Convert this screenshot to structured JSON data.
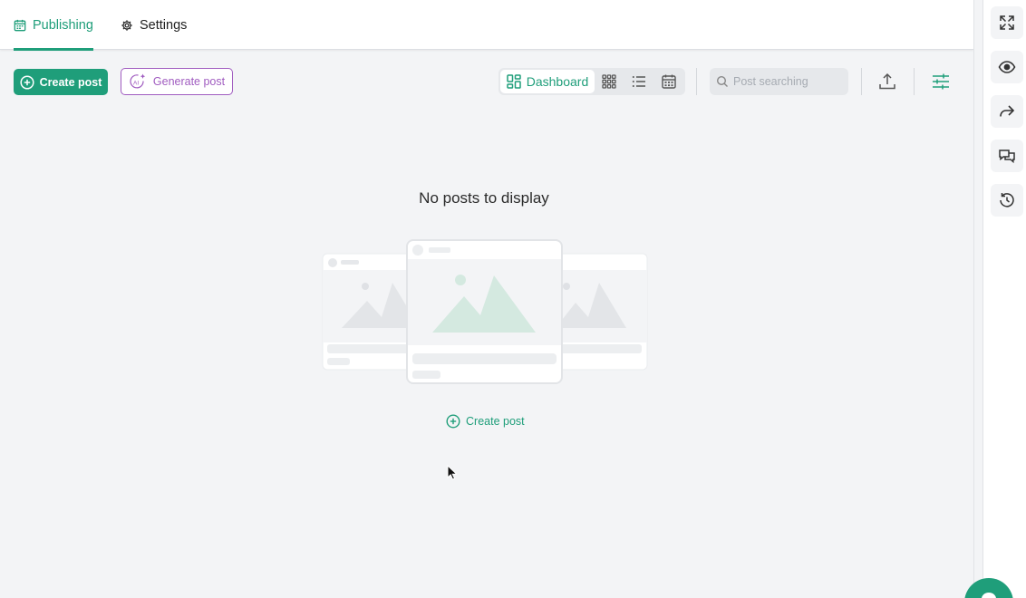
{
  "tabs": {
    "publishing": "Publishing",
    "settings": "Settings"
  },
  "toolbar": {
    "create_post": "Create post",
    "generate_post": "Generate post",
    "view_dashboard": "Dashboard",
    "search_placeholder": "Post searching"
  },
  "empty_state": {
    "title": "No posts to display",
    "create_post": "Create post"
  },
  "colors": {
    "accent": "#1f9e7a",
    "ai_purple": "#a05cc0",
    "background": "#f3f4f6"
  },
  "icons": [
    "calendar-icon",
    "gear-icon",
    "plus-circle-icon",
    "ai-sparkle-icon",
    "dashboard-icon",
    "grid-icon",
    "list-icon",
    "calendar-view-icon",
    "search-icon",
    "upload-icon",
    "filter-sliders-icon",
    "expand-icon",
    "eye-icon",
    "share-icon",
    "comments-icon",
    "history-icon"
  ]
}
